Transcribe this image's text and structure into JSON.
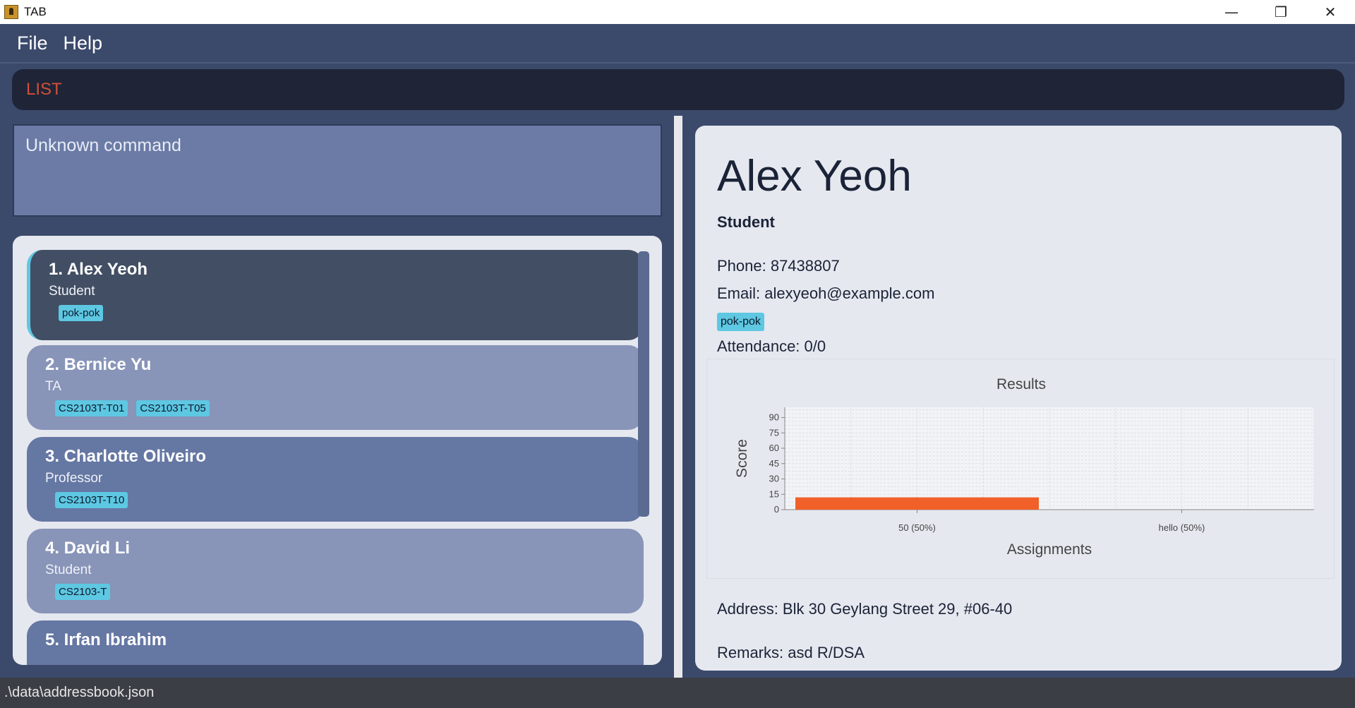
{
  "window": {
    "title": "TAB",
    "minimize": "—",
    "restore": "❐",
    "close": "✕"
  },
  "menu": {
    "file": "File",
    "help": "Help"
  },
  "command": {
    "value": "LIST"
  },
  "result": {
    "text": "Unknown command"
  },
  "persons": [
    {
      "name": "1.  Alex Yeoh",
      "role": "Student",
      "tags": [
        "pok-pok"
      ]
    },
    {
      "name": "2.  Bernice Yu",
      "role": "TA",
      "tags": [
        "CS2103T-T01",
        "CS2103T-T05"
      ]
    },
    {
      "name": "3.  Charlotte Oliveiro",
      "role": "Professor",
      "tags": [
        "CS2103T-T10"
      ]
    },
    {
      "name": "4.  David Li",
      "role": "Student",
      "tags": [
        "CS2103-T"
      ]
    },
    {
      "name": "5.  Irfan Ibrahim",
      "role": "",
      "tags": []
    }
  ],
  "detail": {
    "name": "Alex Yeoh",
    "role": "Student",
    "phone": "Phone: 87438807",
    "email": "Email: alexyeoh@example.com",
    "tag": "pok-pok",
    "attendance": "Attendance: 0/0",
    "address": "Address: Blk 30 Geylang Street 29, #06-40",
    "remarks": "Remarks: asd R/DSA"
  },
  "chart_data": {
    "type": "bar",
    "title": "Results",
    "xlabel": "Assignments",
    "ylabel": "Score",
    "categories": [
      "50 (50%)",
      "hello (50%)"
    ],
    "values": [
      12,
      0
    ],
    "ylim": [
      0,
      100
    ],
    "yticks": [
      0,
      15,
      30,
      45,
      60,
      75,
      90
    ],
    "color": "#f06028",
    "grid": true
  },
  "status": {
    "path": ".\\data\\addressbook.json"
  },
  "colors": {
    "accent": "#5ec7e2",
    "command_text": "#d0503a",
    "bar": "#f06028"
  }
}
